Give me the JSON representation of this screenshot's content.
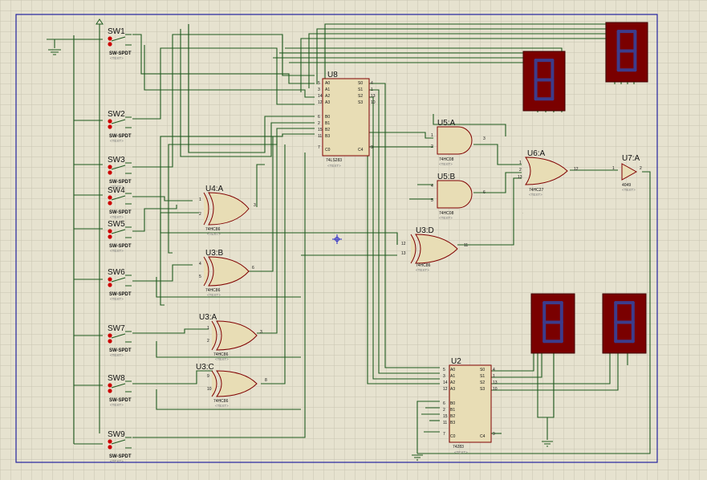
{
  "colors": {
    "background": "#e6e2cf",
    "grid": "#c8c4b0",
    "wire": "#1e5a1e",
    "component_outline": "#800000",
    "component_fill": "#e8ddb5",
    "display_bg": "#7a0000",
    "display_segment": "#3c3c8c",
    "frame": "#2323a0",
    "switch_pin": "#cc0000"
  },
  "switches": [
    {
      "ref": "SW1",
      "type": "SW-SPDT",
      "tag": "<TEXT>"
    },
    {
      "ref": "SW2",
      "type": "SW-SPDT",
      "tag": "<TEXT>"
    },
    {
      "ref": "SW3",
      "type": "SW-SPDT",
      "tag": "<TEXT>"
    },
    {
      "ref": "SW4",
      "type": "SW-SPDT",
      "tag": "<TEXT>"
    },
    {
      "ref": "SW5",
      "type": "SW-SPDT",
      "tag": "<TEXT>"
    },
    {
      "ref": "SW6",
      "type": "SW-SPDT",
      "tag": "<TEXT>"
    },
    {
      "ref": "SW7",
      "type": "SW-SPDT",
      "tag": "<TEXT>"
    },
    {
      "ref": "SW8",
      "type": "SW-SPDT",
      "tag": "<TEXT>"
    },
    {
      "ref": "SW9",
      "type": "SW-SPDT",
      "tag": "<TEXT>"
    }
  ],
  "xor_gates": [
    {
      "ref": "U4:A",
      "part": "74HC86",
      "tag": "<TEXT>",
      "in_a": "1",
      "in_b": "2",
      "out": "3"
    },
    {
      "ref": "U3:B",
      "part": "74HC86",
      "tag": "<TEXT>",
      "in_a": "4",
      "in_b": "5",
      "out": "6"
    },
    {
      "ref": "U3:A",
      "part": "74HC86",
      "tag": "<TEXT>",
      "in_a": "1",
      "in_b": "2",
      "out": "3"
    },
    {
      "ref": "U3:C",
      "part": "74HC86",
      "tag": "<TEXT>",
      "in_a": "9",
      "in_b": "10",
      "out": "8"
    },
    {
      "ref": "U3:D",
      "part": "74HC86",
      "tag": "<TEXT>",
      "in_a": "12",
      "in_b": "13",
      "out": "11"
    }
  ],
  "and_gates": [
    {
      "ref": "U5:A",
      "part": "74HC08",
      "tag": "<TEXT>",
      "in_a": "1",
      "in_b": "2",
      "out": "3"
    },
    {
      "ref": "U5:B",
      "part": "74HC08",
      "tag": "<TEXT>",
      "in_a": "4",
      "in_b": "5",
      "out": "6"
    }
  ],
  "or_gate": {
    "ref": "U6:A",
    "part": "74HC27",
    "tag": "<TEXT>",
    "in_a": "1",
    "in_b": "2",
    "in_c": "13",
    "out": "12"
  },
  "buffer": {
    "ref": "U7:A",
    "part": "4049",
    "tag": "<TEXT>",
    "in": "1",
    "out": "2"
  },
  "adders": [
    {
      "ref": "U8",
      "part": "74LS283",
      "tag": "<TEXT>",
      "left_pins": [
        "A0",
        "A1",
        "A2",
        "A3",
        "B0",
        "B1",
        "B2",
        "B3"
      ],
      "left_nums": [
        "5",
        "3",
        "14",
        "12",
        "6",
        "2",
        "15",
        "11"
      ],
      "right_pins": [
        "S0",
        "S1",
        "S2",
        "S3"
      ],
      "right_nums": [
        "4",
        "1",
        "13",
        "10"
      ],
      "c0": "C0",
      "c4": "C4",
      "c0_num": "7",
      "c4_num": "9"
    },
    {
      "ref": "U2",
      "part": "74283",
      "tag": "<TEXT>",
      "left_pins": [
        "A0",
        "A1",
        "A2",
        "A3",
        "B0",
        "B1",
        "B2",
        "B3"
      ],
      "left_nums": [
        "5",
        "3",
        "14",
        "12",
        "6",
        "2",
        "15",
        "11"
      ],
      "right_pins": [
        "S0",
        "S1",
        "S2",
        "S3"
      ],
      "right_nums": [
        "4",
        "1",
        "13",
        "10"
      ],
      "c0": "C0",
      "c4": "C4",
      "c0_num": "7",
      "c4_num": "9"
    }
  ],
  "displays": [
    {
      "name": "display-top-left",
      "digit": "8"
    },
    {
      "name": "display-top-right",
      "digit": "8"
    },
    {
      "name": "display-bottom-left",
      "digit": "8"
    },
    {
      "name": "display-bottom-right",
      "digit": "8"
    }
  ]
}
